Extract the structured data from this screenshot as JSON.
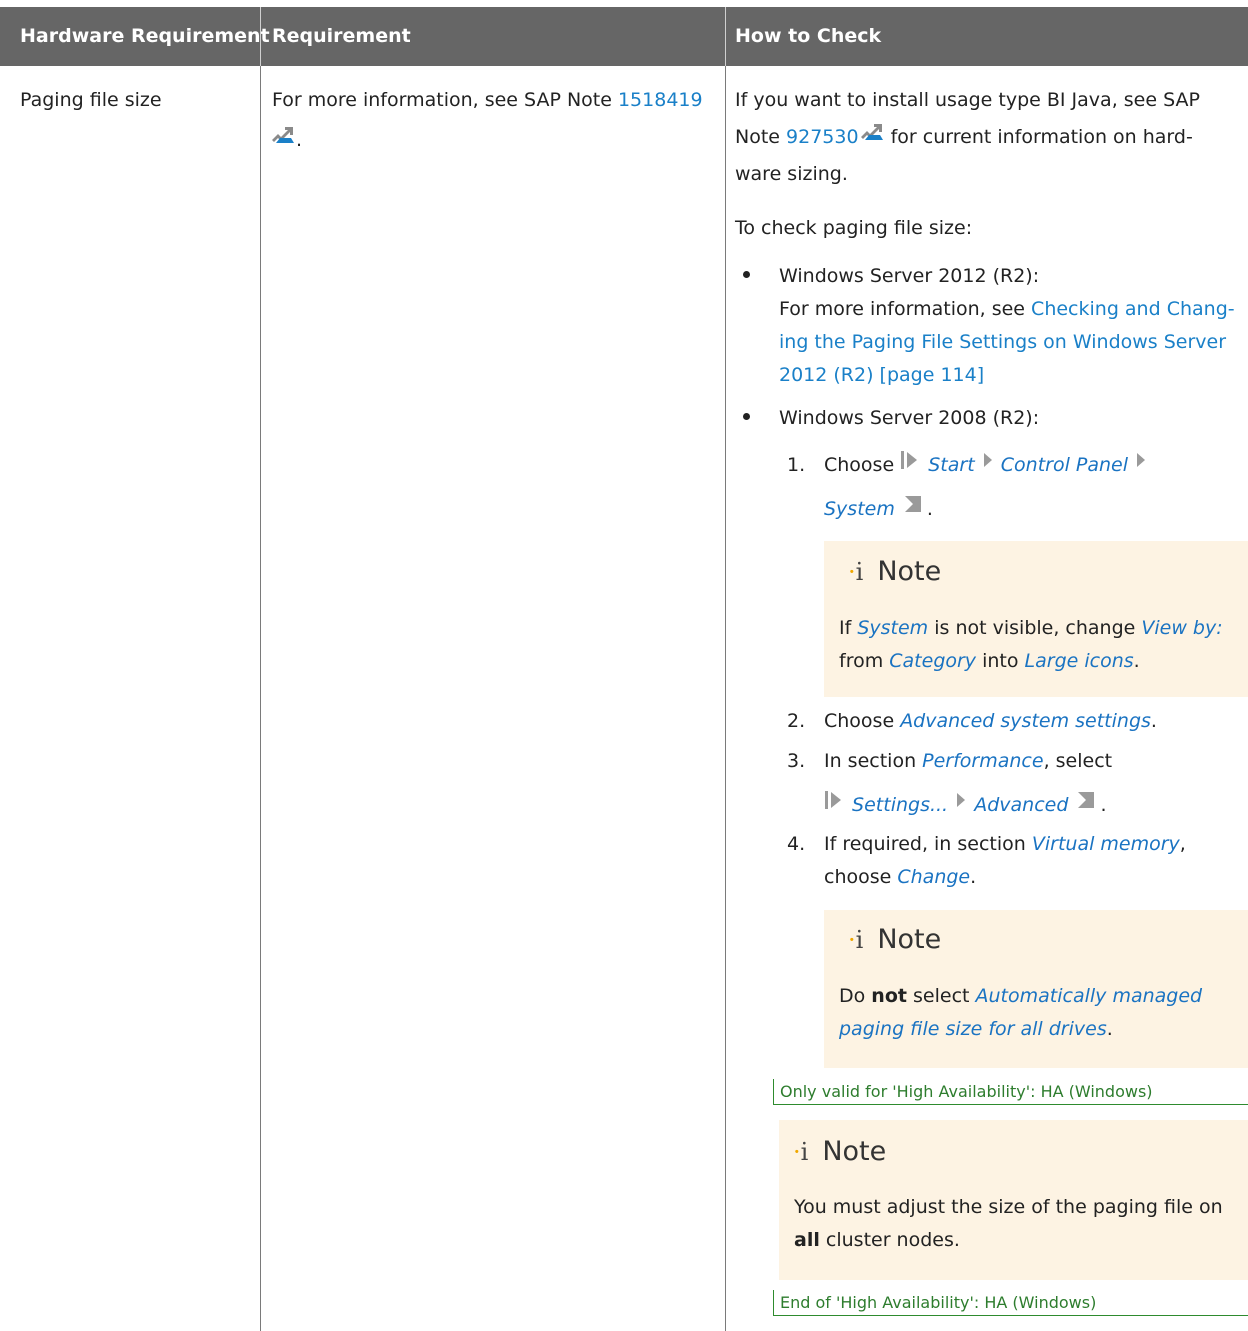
{
  "headers": [
    "Hardware Requirement",
    "Requirement",
    "How to Check"
  ],
  "row": {
    "hardware_requirement": "Paging file size",
    "requirement": {
      "text": "For more information, see SAP Note ",
      "note_link": "1518419",
      "tail": "."
    },
    "how_to_check": {
      "intro_1": "If you want to install usage type BI Java, see SAP",
      "intro_2a": "Note ",
      "intro_note_link": "927530",
      "intro_2b": " for current information on hard-",
      "intro_3": "ware sizing.",
      "check_intro": "To check paging file size:",
      "bullet1_title": "Windows Server 2012 (R2):",
      "bullet1_text": "For more information, see ",
      "bullet1_link_1": "Checking and Chang-",
      "bullet1_link_2": "ing the Paging File Settings on Windows Server",
      "bullet1_link_3": "2012 (R2) [page 114]",
      "bullet2_title": "Windows Server 2008 (R2):",
      "step1_num": "1.",
      "step1_text": "Choose",
      "step1_path": [
        "Start",
        "Control Panel",
        "System"
      ],
      "note1_title": "Note",
      "note1_a": "If ",
      "note1_ui1": "System",
      "note1_b": " is not visible, change ",
      "note1_ui2": "View by:",
      "note1_c": "from ",
      "note1_ui3": "Category",
      "note1_d": " into ",
      "note1_ui4": "Large icons",
      "note1_e": ".",
      "step2_num": "2.",
      "step2_text": "Choose ",
      "step2_ui": "Advanced system settings",
      "step2_tail": ".",
      "step3_num": "3.",
      "step3_text": "In section ",
      "step3_ui": "Performance",
      "step3_tail": ", select",
      "step3_path": [
        "Settings...",
        "Advanced"
      ],
      "step4_num": "4.",
      "step4_text": "If required, in section ",
      "step4_ui": "Virtual memory",
      "step4_tail": ",",
      "step4_line2": "choose ",
      "step4_ui2": "Change",
      "step4_tail2": ".",
      "note2_title": "Note",
      "note2_a": "Do ",
      "note2_bold": "not",
      "note2_b": " select ",
      "note2_ui_1": "Automatically managed",
      "note2_ui_2": "paging file size for all drives",
      "note2_c": ".",
      "ha_start": "Only valid for 'High Availability': HA (Windows)",
      "note3_title": "Note",
      "note3_line1": "You must adjust the size of the paging file on",
      "note3_bold": "all",
      "note3_line2": " cluster nodes.",
      "ha_end": "End of 'High Availability': HA (Windows)"
    }
  },
  "icons": [
    "external-link-icon",
    "info-icon",
    "menu-path-arrow-icon"
  ],
  "colors": {
    "header_bg": "#666666",
    "link": "#1a80c8",
    "note_bg": "#fdf3e3",
    "ha_marker": "#2e7d2e"
  }
}
